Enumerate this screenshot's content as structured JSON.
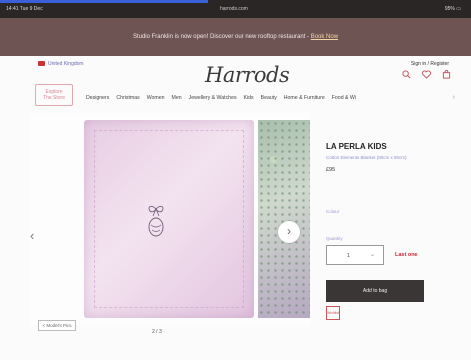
{
  "status_bar": {
    "time": "14:41  Tue 9 Dec",
    "url": "harrods.com",
    "right": "95% ▭"
  },
  "promo": {
    "message": "Studio Franklin is now open! Discover our new rooftop restaurant - ",
    "link": "Book Now"
  },
  "header": {
    "region": "United Kingdom",
    "signin": "Sign in / Register",
    "logo": "Harrods",
    "icons": [
      "search-icon",
      "heart-icon",
      "bag-icon"
    ]
  },
  "explore": {
    "line1": "Explore",
    "line2": "The Store"
  },
  "nav": [
    "Designers",
    "Christmas",
    "Women",
    "Men",
    "Jewellery & Watches",
    "Kids",
    "Beauty",
    "Home & Furniture",
    "Food & Wi"
  ],
  "gallery": {
    "counter": "2 / 3",
    "pics_button": "< Model's Pics"
  },
  "product": {
    "sku": "",
    "brand": "LA PERLA KIDS",
    "name": "Cotton Elements Blanket (80cm x 80cm)",
    "price": "£95",
    "colour_label": "Colour",
    "colour_value": "",
    "quantity_label": "Quantity",
    "quantity_value": "1",
    "stock_status": "Last one",
    "add_to_bag": "Add to bag",
    "wishlist": "Wishlist"
  },
  "footer_text": ""
}
